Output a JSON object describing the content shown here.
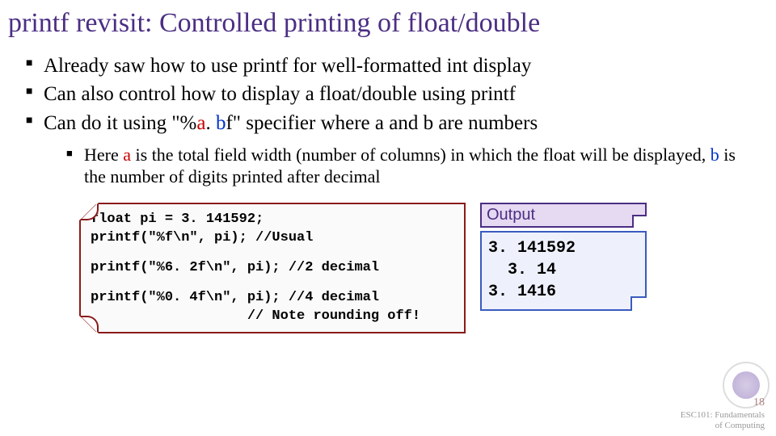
{
  "title": "printf revisit: Controlled printing of float/double",
  "bullets": [
    "Already saw how to use printf for well-formatted int display",
    "Can also control how to display a float/double using printf"
  ],
  "bullet3_parts": {
    "p1": "Can do it using \"%",
    "a": "a",
    "p2": ". ",
    "b": "b",
    "p3": "f\" specifier where a and b are numbers"
  },
  "sub_bullet": {
    "p1": "Here ",
    "a": "a",
    "p2": " is the total field width (number of columns) in which the float will be displayed, ",
    "b": "b",
    "p3": " is the number of digits printed after decimal"
  },
  "code": {
    "block1": "float pi = 3. 141592;\nprintf(\"%f\\n\", pi); //Usual",
    "block2": "printf(\"%6. 2f\\n\", pi); //2 decimal",
    "block3": "printf(\"%0. 4f\\n\", pi); //4 decimal\n                   // Note rounding off!"
  },
  "output": {
    "label": "Output",
    "body": "3. 141592\n  3. 14\n3. 1416"
  },
  "footer": {
    "page": "18",
    "course": "ESC101: Fundamentals\nof Computing"
  }
}
